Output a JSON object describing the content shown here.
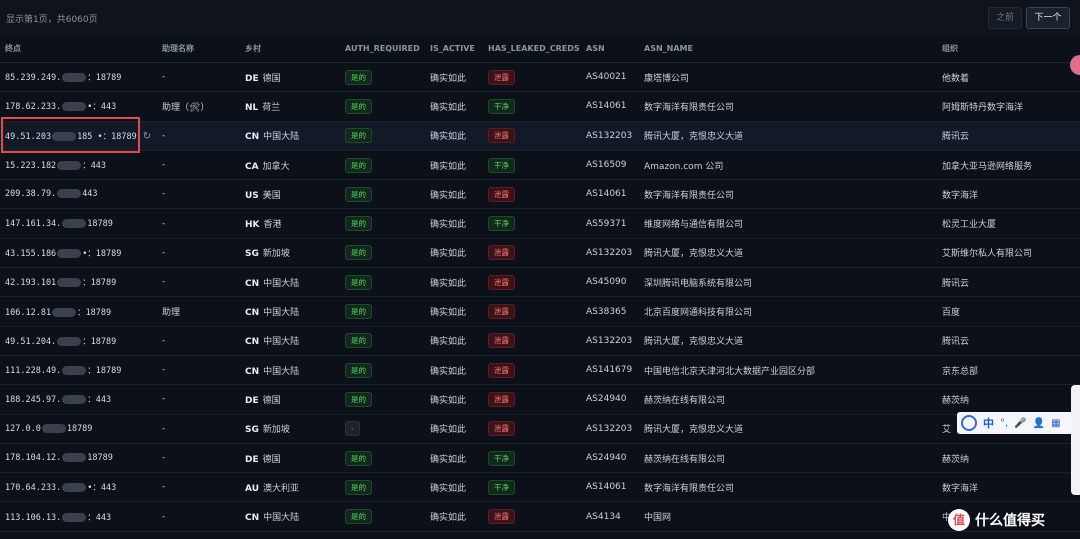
{
  "pager": {
    "info": "显示第1页，共6060页",
    "prev_label": "之前",
    "next_label": "下一个"
  },
  "columns": [
    "终点",
    "助理名称",
    "乡村",
    "AUTH_REQUIRED",
    "IS_ACTIVE",
    "HAS_LEAKED_CREDS",
    "ASN",
    "ASN_NAME",
    "组织"
  ],
  "rows": [
    {
      "ip1": "85.239.249.",
      "ip2": "：18789",
      "assistant": "-",
      "cc": "DE",
      "country": "德国",
      "auth": "是的",
      "active": "确实如此",
      "leak": "泄露",
      "asn": "AS40021",
      "asn_name": "康塔博公司",
      "org": "他数着"
    },
    {
      "ip1": "178.62.233.",
      "ip2": "•：443",
      "assistant": "助理（🛠）",
      "cc": "NL",
      "country": "荷兰",
      "auth": "是的",
      "active": "确实如此",
      "leak": "干净",
      "asn": "AS14061",
      "asn_name": "数字海洋有限责任公司",
      "org": "阿姆斯特丹数字海洋"
    },
    {
      "ip1": "49.51.203",
      "ip2": "185 •：18789",
      "assistant": "-",
      "cc": "CN",
      "country": "中国大陆",
      "auth": "是的",
      "active": "确实如此",
      "leak": "泄露",
      "asn": "AS132203",
      "asn_name": "腾讯大厦，克恨忠义大道",
      "org": "腾讯云"
    },
    {
      "ip1": "15.223.182",
      "ip2": "：443",
      "assistant": "-",
      "cc": "CA",
      "country": "加拿大",
      "auth": "是的",
      "active": "确实如此",
      "leak": "干净",
      "asn": "AS16509",
      "asn_name": "Amazon.com 公司",
      "org": "加拿大亚马逊网络服务"
    },
    {
      "ip1": "209.38.79.",
      "ip2": "443",
      "assistant": "-",
      "cc": "US",
      "country": "美国",
      "auth": "是的",
      "active": "确实如此",
      "leak": "泄露",
      "asn": "AS14061",
      "asn_name": "数字海洋有限责任公司",
      "org": "数字海洋"
    },
    {
      "ip1": "147.161.34.",
      "ip2": "18789",
      "assistant": "-",
      "cc": "HK",
      "country": "香港",
      "auth": "是的",
      "active": "确实如此",
      "leak": "干净",
      "asn": "AS59371",
      "asn_name": "维度网络与通信有限公司",
      "org": "松灵工业大厦"
    },
    {
      "ip1": "43.155.186",
      "ip2": "•：18789",
      "assistant": "-",
      "cc": "SG",
      "country": "新加坡",
      "auth": "是的",
      "active": "确实如此",
      "leak": "泄露",
      "asn": "AS132203",
      "asn_name": "腾讯大厦，克恨忠义大道",
      "org": "艾斯维尔私人有限公司"
    },
    {
      "ip1": "42.193.101",
      "ip2": "：18789",
      "assistant": "-",
      "cc": "CN",
      "country": "中国大陆",
      "auth": "是的",
      "active": "确实如此",
      "leak": "泄露",
      "asn": "AS45090",
      "asn_name": "深圳腾讯电脑系统有限公司",
      "org": "腾讯云"
    },
    {
      "ip1": "106.12.81",
      "ip2": "：18789",
      "assistant": "助理",
      "cc": "CN",
      "country": "中国大陆",
      "auth": "是的",
      "active": "确实如此",
      "leak": "泄露",
      "asn": "AS38365",
      "asn_name": "北京百度网通科技有限公司",
      "org": "百度"
    },
    {
      "ip1": "49.51.204.",
      "ip2": "：18789",
      "assistant": "-",
      "cc": "CN",
      "country": "中国大陆",
      "auth": "是的",
      "active": "确实如此",
      "leak": "泄露",
      "asn": "AS132203",
      "asn_name": "腾讯大厦，克恨忠义大道",
      "org": "腾讯云"
    },
    {
      "ip1": "111.228.49.",
      "ip2": "：18789",
      "assistant": "-",
      "cc": "CN",
      "country": "中国大陆",
      "auth": "是的",
      "active": "确实如此",
      "leak": "泄露",
      "asn": "AS141679",
      "asn_name": "中国电信北京天津河北大数据产业园区分部",
      "org": "京东总部"
    },
    {
      "ip1": "188.245.97.",
      "ip2": "：443",
      "assistant": "-",
      "cc": "DE",
      "country": "德国",
      "auth": "是的",
      "active": "确实如此",
      "leak": "泄露",
      "asn": "AS24940",
      "asn_name": "赫茨纳在线有限公司",
      "org": "赫茨纳"
    },
    {
      "ip1": "127.0.0",
      "ip2": "18789",
      "assistant": "-",
      "cc": "SG",
      "country": "新加坡",
      "auth": "-",
      "active": "确实如此",
      "leak": "泄露",
      "asn": "AS132203",
      "asn_name": "腾讯大厦，克恨忠义大道",
      "org": "艾"
    },
    {
      "ip1": "178.104.12.",
      "ip2": "18789",
      "assistant": "-",
      "cc": "DE",
      "country": "德国",
      "auth": "是的",
      "active": "确实如此",
      "leak": "干净",
      "asn": "AS24940",
      "asn_name": "赫茨纳在线有限公司",
      "org": "赫茨纳"
    },
    {
      "ip1": "170.64.233.",
      "ip2": "•：443",
      "assistant": "-",
      "cc": "AU",
      "country": "澳大利亚",
      "auth": "是的",
      "active": "确实如此",
      "leak": "干净",
      "asn": "AS14061",
      "asn_name": "数字海洋有限责任公司",
      "org": "数字海洋"
    },
    {
      "ip1": "113.106.13.",
      "ip2": "：443",
      "assistant": "-",
      "cc": "CN",
      "country": "中国大陆",
      "auth": "是的",
      "active": "确实如此",
      "leak": "泄露",
      "asn": "AS4134",
      "asn_name": "中国网",
      "org": "中"
    }
  ],
  "ime_toolbar": {
    "lang": "中"
  },
  "watermark": {
    "logo": "值",
    "text": "什么值得买"
  }
}
